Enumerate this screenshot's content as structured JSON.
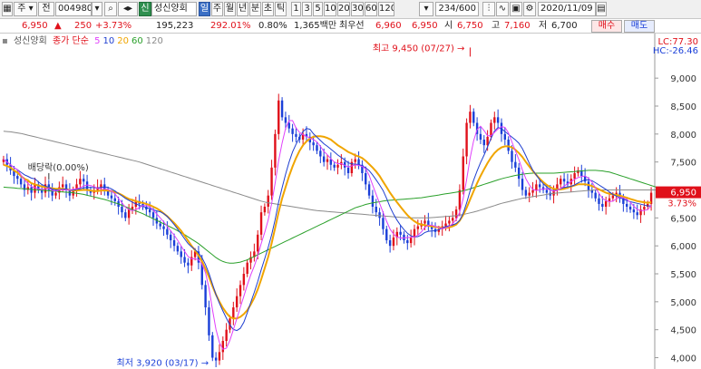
{
  "toolbar": {
    "type_label": "주",
    "mode_label": "전",
    "code": "004980",
    "search_icon": "magnifier-icon",
    "new_badge": "신",
    "stock_name": "성신양회",
    "periods": [
      "일",
      "주",
      "월",
      "년",
      "분",
      "초",
      "틱"
    ],
    "active_period": "일",
    "intervals": [
      "1",
      "3",
      "5",
      "10",
      "20",
      "30",
      "60",
      "120"
    ],
    "count": "234",
    "count_total": "/600",
    "date": "2020/11/09",
    "icons": [
      "chart-type-icon",
      "indicator-icon",
      "save-icon",
      "settings-icon",
      "calendar-icon"
    ]
  },
  "quote": {
    "price": "6,950",
    "change": "250",
    "change_pct": "+3.73%",
    "volume": "195,223",
    "vol_ratio": "292.01%",
    "turnover": "0.80%",
    "amount": "1,365백만",
    "kind": "최우선",
    "ask": "6,960",
    "bid": "6,950",
    "open_label": "시",
    "open": "6,750",
    "high_label": "고",
    "high": "7,160",
    "low_label": "저",
    "low": "6,700",
    "buy_label": "매수",
    "sell_label": "매도"
  },
  "legend": {
    "name": "성신양회",
    "type": "종가 단순",
    "periods": [
      "5",
      "10",
      "20",
      "60",
      "120"
    ],
    "colors": [
      "#e040fb",
      "#1f3fd0",
      "#f0a500",
      "#2aa02a",
      "#8a8a8a"
    ]
  },
  "side": {
    "lc": "LC:77.30",
    "hc": "HC:-26.46",
    "last_price": "6,950",
    "last_pct": "3.73%"
  },
  "chart_data": {
    "type": "candlestick",
    "yaxis": {
      "ticks": [
        4000,
        4500,
        5000,
        5500,
        6000,
        6500,
        7000,
        7500,
        8000,
        8500,
        9000
      ],
      "tick_labels": [
        "4,000",
        "4,500",
        "5,000",
        "5,500",
        "6,000",
        "6,500",
        "7,000",
        "7,500",
        "8,000",
        "8,500",
        "9,000"
      ],
      "range": [
        3830,
        9700
      ]
    },
    "annotations": {
      "high_text": "최고 9,450 (07/27)",
      "high_value": 9450,
      "low_text": "최저 3,920 (03/17)",
      "low_value": 3920,
      "dividend_text": "배당락(0.00%)"
    },
    "colors": {
      "up": "#e0101a",
      "down": "#1a3fd8",
      "ma5": "#e040fb",
      "ma10": "#1f3fd0",
      "ma20": "#f0a500",
      "ma60": "#2aa02a",
      "ma120": "#8a8a8a"
    },
    "closes": [
      7550,
      7450,
      7350,
      7250,
      7200,
      7100,
      7000,
      7050,
      6950,
      7100,
      7000,
      6950,
      7100,
      7000,
      6900,
      6950,
      7050,
      7100,
      7000,
      6900,
      7000,
      7100,
      7200,
      7150,
      7000,
      6950,
      7000,
      7050,
      7100,
      7000,
      6900,
      6850,
      6800,
      6700,
      6600,
      6500,
      6650,
      6700,
      6800,
      6750,
      6700,
      6650,
      6600,
      6500,
      6400,
      6350,
      6300,
      6200,
      6100,
      6000,
      5900,
      5800,
      5700,
      5650,
      5800,
      5900,
      5700,
      5300,
      4900,
      4400,
      4000,
      3950,
      4100,
      4300,
      4500,
      4700,
      4900,
      5100,
      5300,
      5500,
      5700,
      5800,
      5900,
      6200,
      6600,
      6700,
      6900,
      7400,
      8000,
      8600,
      8300,
      8200,
      8100,
      8000,
      7950,
      7900,
      8000,
      7950,
      7850,
      7800,
      7700,
      7600,
      7500,
      7550,
      7450,
      7400,
      7450,
      7500,
      7400,
      7300,
      7500,
      7550,
      7450,
      7300,
      7100,
      6900,
      6700,
      6600,
      6500,
      6300,
      6100,
      6000,
      6150,
      6250,
      6200,
      6100,
      6050,
      6150,
      6300,
      6350,
      6400,
      6450,
      6350,
      6300,
      6250,
      6300,
      6350,
      6400,
      6450,
      6500,
      6650,
      7000,
      7600,
      8200,
      8400,
      8200,
      8000,
      7900,
      7800,
      7950,
      8200,
      8300,
      8200,
      8000,
      7900,
      7700,
      7500,
      7400,
      7200,
      7000,
      6900,
      6950,
      7000,
      7100,
      7050,
      7000,
      6950,
      6900,
      7000,
      7100,
      7200,
      7150,
      7100,
      7200,
      7300,
      7350,
      7250,
      7150,
      7000,
      6950,
      6850,
      6750,
      6700,
      6800,
      6850,
      6900,
      6950,
      6850,
      6750,
      6700,
      6650,
      6600,
      6550,
      6650,
      6700,
      6750,
      6950
    ],
    "ma20": [
      7450,
      7430,
      7400,
      7350,
      7310,
      7250,
      7200,
      7170,
      7120,
      7100,
      7080,
      7060,
      7050,
      7040,
      7030,
      7020,
      7020,
      7020,
      7010,
      7000,
      6990,
      6990,
      6995,
      7000,
      7000,
      6990,
      6980,
      6980,
      6990,
      6990,
      6990,
      6980,
      6960,
      6940,
      6910,
      6870,
      6840,
      6820,
      6800,
      6780,
      6770,
      6750,
      6730,
      6700,
      6670,
      6630,
      6580,
      6530,
      6470,
      6410,
      6340,
      6270,
      6180,
      6090,
      6000,
      5920,
      5830,
      5720,
      5590,
      5440,
      5280,
      5130,
      5000,
      4890,
      4800,
      4730,
      4700,
      4700,
      4730,
      4780,
      4850,
      4950,
      5070,
      5220,
      5400,
      5600,
      5800,
      6050,
      6320,
      6600,
      6850,
      7050,
      7250,
      7420,
      7570,
      7700,
      7800,
      7870,
      7920,
      7950,
      7960,
      7960,
      7950,
      7930,
      7900,
      7850,
      7800,
      7760,
      7720,
      7680,
      7650,
      7620,
      7600,
      7570,
      7520,
      7460,
      7400,
      7330,
      7250,
      7150,
      7050,
      6950,
      6860,
      6780,
      6700,
      6620,
      6550,
      6490,
      6440,
      6400,
      6380,
      6370,
      6360,
      6350,
      6340,
      6330,
      6320,
      6320,
      6330,
      6350,
      6380,
      6450,
      6550,
      6680,
      6830,
      6980,
      7120,
      7250,
      7370,
      7480,
      7580,
      7660,
      7720,
      7760,
      7780,
      7780,
      7760,
      7720,
      7660,
      7590,
      7500,
      7420,
      7340,
      7270,
      7200,
      7140,
      7090,
      7050,
      7020,
      7010,
      7010,
      7020,
      7040,
      7060,
      7080,
      7100,
      7100,
      7100,
      7090,
      7070,
      7040,
      7010,
      6980,
      6950,
      6930,
      6920,
      6910,
      6900,
      6880,
      6860,
      6840,
      6820,
      6800,
      6790,
      6780,
      6770,
      6780
    ],
    "ma60": [
      7050,
      7045,
      7040,
      7035,
      7030,
      7025,
      7020,
      7015,
      7010,
      7005,
      7000,
      6995,
      6990,
      6985,
      6980,
      6975,
      6970,
      6965,
      6960,
      6955,
      6950,
      6940,
      6930,
      6920,
      6905,
      6890,
      6875,
      6860,
      6845,
      6830,
      6810,
      6790,
      6770,
      6750,
      6725,
      6700,
      6675,
      6650,
      6625,
      6600,
      6575,
      6545,
      6515,
      6485,
      6455,
      6425,
      6395,
      6365,
      6335,
      6305,
      6270,
      6235,
      6200,
      6160,
      6120,
      6080,
      6040,
      5990,
      5940,
      5890,
      5840,
      5790,
      5750,
      5720,
      5700,
      5690,
      5690,
      5700,
      5710,
      5730,
      5750,
      5780,
      5810,
      5840,
      5870,
      5900,
      5930,
      5960,
      5990,
      6020,
      6050,
      6080,
      6110,
      6140,
      6170,
      6200,
      6230,
      6260,
      6290,
      6320,
      6350,
      6380,
      6410,
      6440,
      6470,
      6500,
      6530,
      6560,
      6590,
      6620,
      6650,
      6680,
      6700,
      6720,
      6740,
      6755,
      6770,
      6780,
      6790,
      6800,
      6810,
      6815,
      6820,
      6825,
      6830,
      6835,
      6840,
      6845,
      6850,
      6855,
      6860,
      6870,
      6880,
      6890,
      6900,
      6910,
      6920,
      6930,
      6940,
      6950,
      6960,
      6970,
      6985,
      7000,
      7020,
      7040,
      7060,
      7080,
      7100,
      7120,
      7140,
      7160,
      7180,
      7200,
      7215,
      7230,
      7245,
      7260,
      7270,
      7280,
      7290,
      7295,
      7300,
      7300,
      7300,
      7300,
      7300,
      7300,
      7300,
      7305,
      7310,
      7315,
      7320,
      7325,
      7330,
      7335,
      7340,
      7345,
      7350,
      7350,
      7350,
      7345,
      7340,
      7330,
      7320,
      7300,
      7280,
      7260,
      7240,
      7220,
      7200,
      7180,
      7160,
      7140,
      7120,
      7100,
      7080,
      7060,
      7040,
      7030
    ],
    "ma120": [
      8050,
      8045,
      8040,
      8030,
      8020,
      8010,
      7995,
      7980,
      7965,
      7950,
      7935,
      7920,
      7905,
      7890,
      7875,
      7860,
      7845,
      7830,
      7815,
      7800,
      7785,
      7770,
      7755,
      7740,
      7725,
      7710,
      7695,
      7680,
      7665,
      7650,
      7635,
      7620,
      7605,
      7590,
      7575,
      7560,
      7545,
      7530,
      7515,
      7500,
      7480,
      7460,
      7440,
      7420,
      7400,
      7380,
      7360,
      7340,
      7320,
      7300,
      7280,
      7260,
      7240,
      7220,
      7200,
      7180,
      7160,
      7140,
      7120,
      7100,
      7080,
      7060,
      7040,
      7020,
      7000,
      6980,
      6960,
      6940,
      6920,
      6900,
      6880,
      6860,
      6840,
      6820,
      6800,
      6785,
      6770,
      6760,
      6750,
      6740,
      6730,
      6720,
      6710,
      6700,
      6690,
      6680,
      6670,
      6660,
      6650,
      6640,
      6630,
      6625,
      6620,
      6615,
      6610,
      6605,
      6600,
      6595,
      6590,
      6585,
      6580,
      6575,
      6570,
      6565,
      6560,
      6555,
      6550,
      6545,
      6540,
      6535,
      6530,
      6525,
      6520,
      6515,
      6510,
      6505,
      6500,
      6500,
      6500,
      6500,
      6500,
      6500,
      6500,
      6505,
      6510,
      6515,
      6520,
      6525,
      6530,
      6535,
      6540,
      6550,
      6560,
      6575,
      6590,
      6605,
      6620,
      6640,
      6660,
      6680,
      6700,
      6720,
      6740,
      6760,
      6775,
      6790,
      6805,
      6820,
      6835,
      6850,
      6860,
      6870,
      6880,
      6890,
      6900,
      6910,
      6920,
      6930,
      6940,
      6945,
      6950,
      6955,
      6960,
      6965,
      6970,
      6975,
      6980,
      6985,
      6990,
      6995,
      7000,
      7000,
      7000,
      7000,
      7000,
      7000,
      7000,
      7000,
      7000,
      7000,
      7000,
      7000,
      7000,
      7000,
      7000,
      7000,
      7000,
      7000,
      7000,
      7000
    ]
  }
}
